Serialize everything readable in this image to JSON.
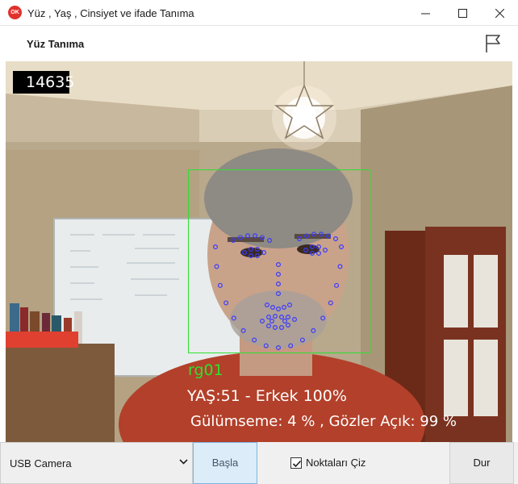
{
  "window": {
    "title": "Yüz , Yaş , Cinsiyet ve ifade Tanıma",
    "app_icon_text": "OK"
  },
  "header": {
    "title": "Yüz Tanıma"
  },
  "camera_view": {
    "frame_counter": "14635",
    "face": {
      "name": "rg01",
      "age_gender": "YAŞ:51 - Erkek 100%",
      "expression": "Gülümseme: 4 % , Gözler Açık: 99 %"
    },
    "colors": {
      "face_box": "#2fe02f",
      "landmarks": "#3a3aff"
    }
  },
  "toolbar": {
    "camera_select_value": "USB Camera",
    "start_label": "Başla",
    "draw_points_label": "Noktaları Çiz",
    "draw_points_checked": true,
    "stop_label": "Dur"
  }
}
